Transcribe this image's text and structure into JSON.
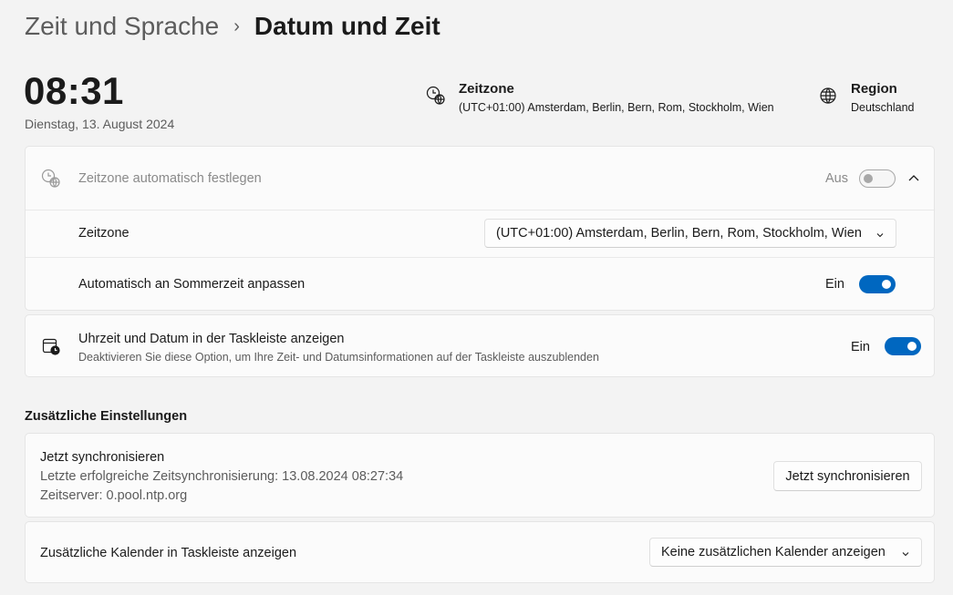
{
  "breadcrumb": {
    "parent": "Zeit und Sprache",
    "separator": "›",
    "current": "Datum und Zeit"
  },
  "clock": {
    "time": "08:31",
    "date": "Dienstag, 13. August 2024"
  },
  "timezone_info": {
    "title": "Zeitzone",
    "value": "(UTC+01:00) Amsterdam, Berlin, Bern, Rom, Stockholm, Wien"
  },
  "region_info": {
    "title": "Region",
    "value": "Deutschland"
  },
  "auto_timezone": {
    "label": "Zeitzone automatisch festlegen",
    "state": "Aus",
    "enabled": false
  },
  "timezone_setting": {
    "label": "Zeitzone",
    "selected": "(UTC+01:00) Amsterdam, Berlin, Bern, Rom, Stockholm, Wien"
  },
  "dst": {
    "label": "Automatisch an Sommerzeit anpassen",
    "state": "Ein",
    "enabled": true
  },
  "taskbar_time": {
    "label": "Uhrzeit und Datum in der Taskleiste anzeigen",
    "description": "Deaktivieren Sie diese Option, um Ihre Zeit- und Datumsinformationen auf der Taskleiste auszublenden",
    "state": "Ein",
    "enabled": true
  },
  "additional": {
    "title": "Zusätzliche Einstellungen",
    "sync": {
      "title": "Jetzt synchronisieren",
      "last_sync": "Letzte erfolgreiche Zeitsynchronisierung: 13.08.2024 08:27:34",
      "server": "Zeitserver: 0.pool.ntp.org",
      "button": "Jetzt synchronisieren"
    },
    "calendar": {
      "label": "Zusätzliche Kalender in Taskleiste anzeigen",
      "selected": "Keine zusätzlichen Kalender anzeigen"
    }
  },
  "colors": {
    "accent": "#0067c0",
    "background": "#f3f3f3",
    "card": "#fbfbfb"
  }
}
